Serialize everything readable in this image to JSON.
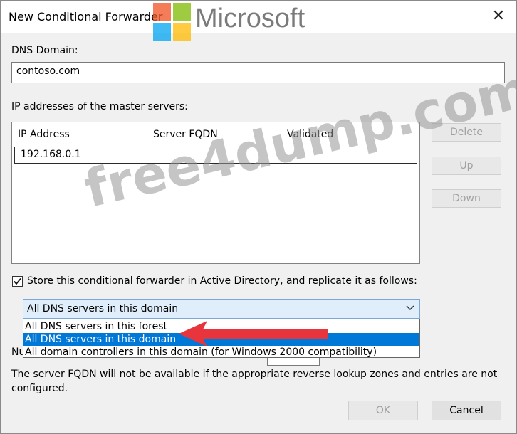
{
  "window": {
    "title": "New Conditional Forwarder",
    "close_glyph": "✕"
  },
  "brand": {
    "text": "Microsoft",
    "colors": [
      "#f25022",
      "#7fba00",
      "#00a4ef",
      "#ffb900"
    ]
  },
  "dns_domain": {
    "label": "DNS Domain:",
    "value": "contoso.com"
  },
  "master_servers": {
    "label": "IP addresses of the master servers:",
    "columns": [
      "IP Address",
      "Server FQDN",
      "Validated"
    ],
    "edit_value": "192.168.0.1"
  },
  "side_buttons": {
    "delete": "Delete",
    "up": "Up",
    "down": "Down"
  },
  "store": {
    "checked": true,
    "label": "Store this conditional forwarder in Active Directory, and replicate it as follows:",
    "selected": "All DNS servers in this domain",
    "options": [
      "All DNS servers in this forest",
      "All DNS servers in this domain",
      "All domain controllers in this domain (for Windows 2000 compatibility)"
    ],
    "highlighted_index": 1
  },
  "partial_label": "Nu",
  "note": "The server FQDN will not be available if the appropriate reverse lookup zones and entries are not configured.",
  "footer": {
    "ok": "OK",
    "cancel": "Cancel"
  },
  "watermark": "free4dump.com",
  "colors": {
    "selection": "#0078d7",
    "arrow": "#e8343c"
  }
}
